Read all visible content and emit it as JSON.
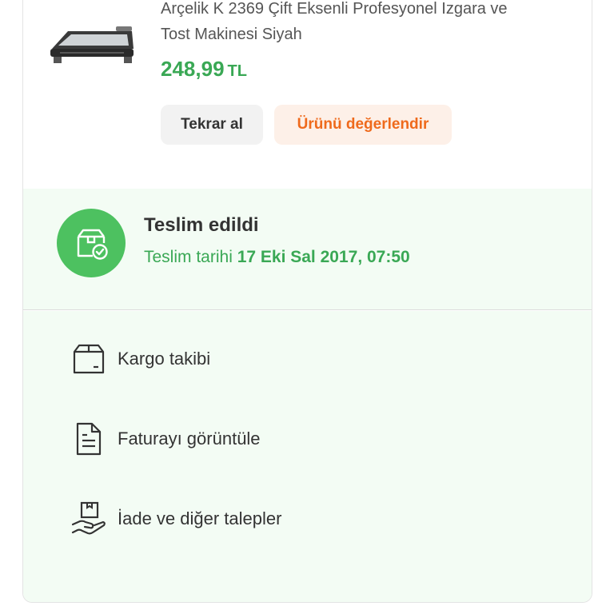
{
  "product": {
    "title_line1": "Arçelik K 2369 Çift Eksenli Profesyonel Izgara ve",
    "title_line2": "Tost Makinesi Siyah",
    "price_value": "248,99",
    "price_currency": "TL",
    "rebuy_label": "Tekrar al",
    "rate_label": "Ürünü değerlendir"
  },
  "delivery": {
    "status": "Teslim edildi",
    "date_prefix": "Teslim tarihi",
    "date_value": "17 Eki Sal 2017, 07:50"
  },
  "actions": [
    {
      "label": "Kargo takibi",
      "icon": "box-icon"
    },
    {
      "label": "Faturayı görüntüle",
      "icon": "invoice-icon"
    },
    {
      "label": "İade ve diğer talepler",
      "icon": "return-hand-box-icon"
    }
  ],
  "colors": {
    "accent_green": "#3aa855",
    "status_circle": "#4dc160",
    "rate_orange": "#ef6a1c",
    "panel_bg": "#f3fcf4"
  }
}
